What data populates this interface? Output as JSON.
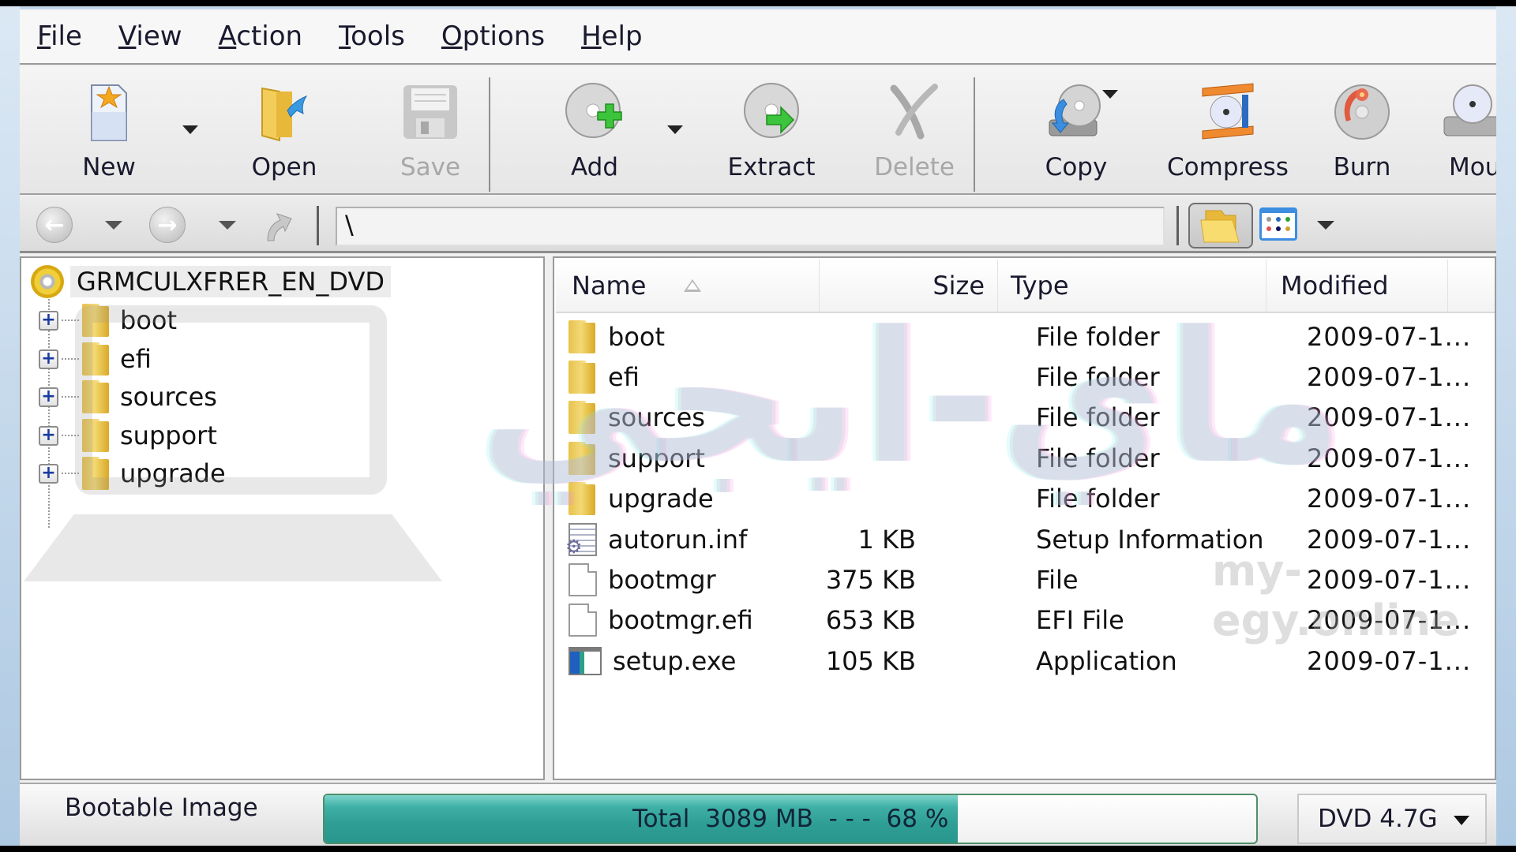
{
  "menu": {
    "items": [
      {
        "label": "File",
        "accel": "F",
        "rest": "ile"
      },
      {
        "label": "View",
        "accel": "V",
        "rest": "iew"
      },
      {
        "label": "Action",
        "accel": "A",
        "rest": "ction"
      },
      {
        "label": "Tools",
        "accel": "T",
        "rest": "ools"
      },
      {
        "label": "Options",
        "accel": "O",
        "rest": "ptions"
      },
      {
        "label": "Help",
        "accel": "H",
        "rest": "elp"
      }
    ]
  },
  "toolbar": {
    "new": {
      "label": "New",
      "icon": "new-document-icon",
      "enabled": true
    },
    "open": {
      "label": "Open",
      "icon": "open-folder-icon",
      "enabled": true
    },
    "save": {
      "label": "Save",
      "icon": "floppy-disk-icon",
      "enabled": false
    },
    "add": {
      "label": "Add",
      "icon": "disc-add-icon",
      "enabled": true
    },
    "extract": {
      "label": "Extract",
      "icon": "disc-extract-icon",
      "enabled": true
    },
    "delete": {
      "label": "Delete",
      "icon": "delete-x-icon",
      "enabled": false
    },
    "copy": {
      "label": "Copy",
      "icon": "disc-copy-icon",
      "enabled": true
    },
    "compress": {
      "label": "Compress",
      "icon": "compress-icon",
      "enabled": true
    },
    "burn": {
      "label": "Burn",
      "icon": "burn-disc-icon",
      "enabled": true
    },
    "mount": {
      "label": "Mou",
      "icon": "mount-drive-icon",
      "enabled": true
    }
  },
  "navbar": {
    "path": "\\"
  },
  "tree": {
    "root": "GRMCULXFRER_EN_DVD",
    "children": [
      {
        "label": "boot"
      },
      {
        "label": "efi"
      },
      {
        "label": "sources"
      },
      {
        "label": "support"
      },
      {
        "label": "upgrade"
      }
    ]
  },
  "list": {
    "columns": {
      "name": "Name",
      "size": "Size",
      "type": "Type",
      "modified": "Modified"
    },
    "sort": {
      "column": "Name",
      "direction": "ascending"
    },
    "rows": [
      {
        "name": "boot",
        "size": "",
        "type": "File folder",
        "modified": "2009-07-1...",
        "icon": "folder"
      },
      {
        "name": "efi",
        "size": "",
        "type": "File folder",
        "modified": "2009-07-1...",
        "icon": "folder"
      },
      {
        "name": "sources",
        "size": "",
        "type": "File folder",
        "modified": "2009-07-1...",
        "icon": "folder"
      },
      {
        "name": "support",
        "size": "",
        "type": "File folder",
        "modified": "2009-07-1...",
        "icon": "folder"
      },
      {
        "name": "upgrade",
        "size": "",
        "type": "File folder",
        "modified": "2009-07-1...",
        "icon": "folder"
      },
      {
        "name": "autorun.inf",
        "size": "1 KB",
        "type": "Setup Information",
        "modified": "2009-07-1...",
        "icon": "inf"
      },
      {
        "name": "bootmgr",
        "size": "375 KB",
        "type": "File",
        "modified": "2009-07-1...",
        "icon": "blank"
      },
      {
        "name": "bootmgr.efi",
        "size": "653 KB",
        "type": "EFI File",
        "modified": "2009-07-1...",
        "icon": "blank"
      },
      {
        "name": "setup.exe",
        "size": "105 KB",
        "type": "Application",
        "modified": "2009-07-1...",
        "icon": "exe"
      }
    ]
  },
  "status": {
    "image_type": "Bootable Image",
    "progress_text": "Total  3089 MB  - - -  68 %",
    "total_mb": 3089,
    "percent": 68,
    "media": "DVD 4.7G"
  },
  "watermark": {
    "latin": "my-egy.online",
    "arabic": "ماي-ايجي"
  }
}
